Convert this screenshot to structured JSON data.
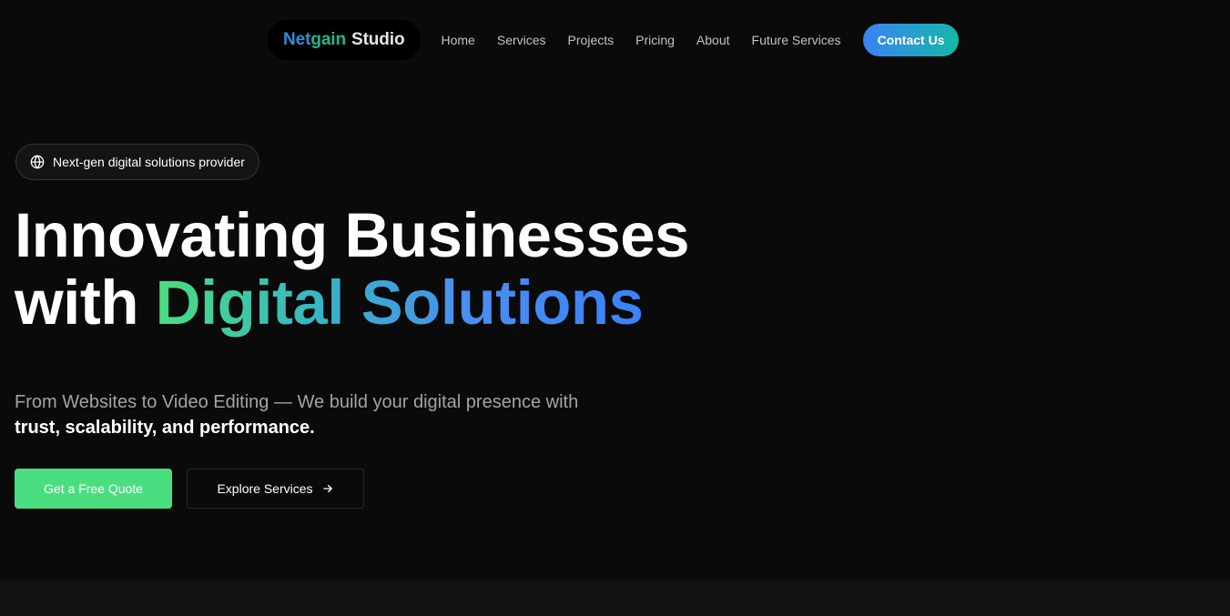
{
  "nav": {
    "logo": {
      "part1": "Net",
      "part2": "gain",
      "part3": "Studio"
    },
    "links": [
      "Home",
      "Services",
      "Projects",
      "Pricing",
      "About",
      "Future Services"
    ],
    "contact_label": "Contact Us"
  },
  "hero": {
    "badge_icon": "globe-icon",
    "badge_text": "Next-gen digital solutions provider",
    "title_line1": "Innovating Businesses",
    "title_line2_prefix": "with ",
    "title_line2_highlight": "Digital Solutions",
    "subtitle_line1": "From Websites to Video Editing — We build your digital presence with",
    "subtitle_line2": "trust, scalability, and performance.",
    "cta_primary": "Get a Free Quote",
    "cta_secondary": "Explore Services",
    "cta_secondary_icon": "arrow-right-icon"
  },
  "colors": {
    "background": "#0a0a0a",
    "accent_green": "#4ade80",
    "accent_blue": "#3b82f6",
    "accent_teal": "#14b8a6"
  }
}
